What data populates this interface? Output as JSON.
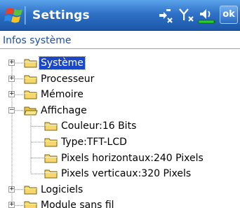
{
  "titlebar": {
    "title": "Settings",
    "ok_label": "ok",
    "icons": [
      "windows-start-icon",
      "connectivity-icon",
      "signal-icon",
      "volume-icon",
      "battery-icon"
    ]
  },
  "header": {
    "title": "Infos système"
  },
  "tree": {
    "nodes": [
      {
        "label": "Système",
        "level": 0,
        "expander": "+",
        "folder": "closed",
        "selected": true
      },
      {
        "label": "Processeur",
        "level": 0,
        "expander": "+",
        "folder": "closed"
      },
      {
        "label": "Mémoire",
        "level": 0,
        "expander": "+",
        "folder": "closed"
      },
      {
        "label": "Affichage",
        "level": 0,
        "expander": "−",
        "folder": "open"
      },
      {
        "label": "Couleur:16 Bits",
        "level": 1,
        "folder": "closed"
      },
      {
        "label": "Type:TFT-LCD",
        "level": 1,
        "folder": "closed"
      },
      {
        "label": "Pixels horizontaux:240 Pixels",
        "level": 1,
        "folder": "closed"
      },
      {
        "label": "Pixels verticaux:320 Pixels",
        "level": 1,
        "folder": "closed"
      },
      {
        "label": "Logiciels",
        "level": 0,
        "expander": "+",
        "folder": "closed"
      },
      {
        "label": "Module sans fil",
        "level": 0,
        "expander": "+",
        "folder": "closed"
      }
    ]
  },
  "colors": {
    "titlebar": "#2f72c8",
    "header_text": "#1c4fa8",
    "selection": "#1a46c8",
    "folder": "#f5d76e"
  }
}
